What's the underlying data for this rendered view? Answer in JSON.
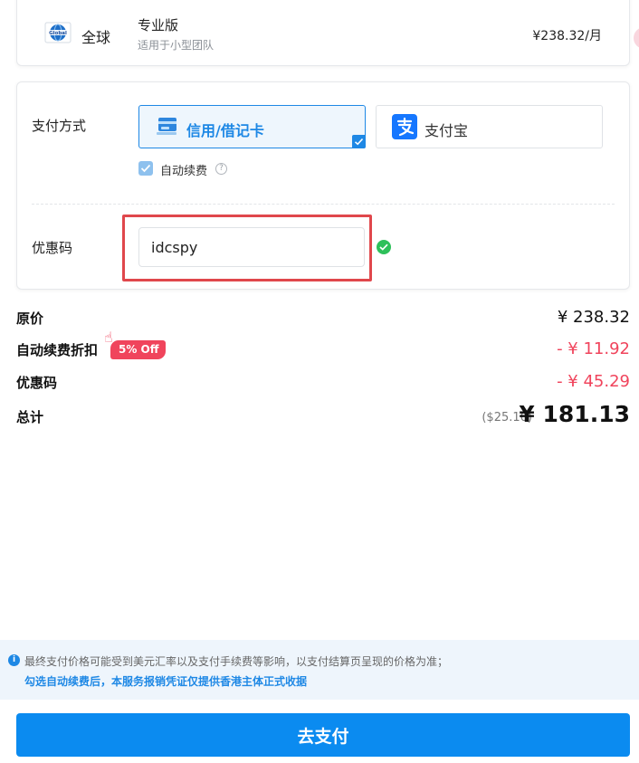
{
  "plan": {
    "region_logo_text": "Global",
    "region_label": "全球",
    "name": "专业版",
    "description": "适用于小型团队",
    "price": "¥238.32/月"
  },
  "payment": {
    "method_label": "支付方式",
    "options": [
      {
        "label": "信用/借记卡",
        "icon": "credit-card-icon",
        "selected": true
      },
      {
        "label": "支付宝",
        "icon": "alipay-icon",
        "selected": false
      }
    ],
    "auto_renew_label": "自动续费",
    "auto_renew_checked": true,
    "coupon_label": "优惠码",
    "coupon_value": "idcspy",
    "coupon_valid": true
  },
  "summary": {
    "original_label": "原价",
    "original_value": "¥ 238.32",
    "auto_discount_label": "自动续费折扣",
    "auto_discount_badge": "5% Off",
    "auto_discount_value": "- ¥ 11.92",
    "coupon_label": "优惠码",
    "coupon_value": "- ¥ 45.29",
    "total_label": "总计",
    "total_usd": "($25.16)",
    "total_value": "¥ 181.13"
  },
  "notice": {
    "line1": "最终支付价格可能受到美元汇率以及支付手续费等影响，以支付结算页呈现的价格为准；",
    "line2": "勾选自动续费后，本服务报销凭证仅提供香港主体正式收据"
  },
  "pay_button": "去支付",
  "colors": {
    "accent": "#1e88e5",
    "pay_button": "#0b8bf0",
    "discount": "#f0445c",
    "highlight_box": "#e0474c",
    "success": "#2ec05a"
  }
}
